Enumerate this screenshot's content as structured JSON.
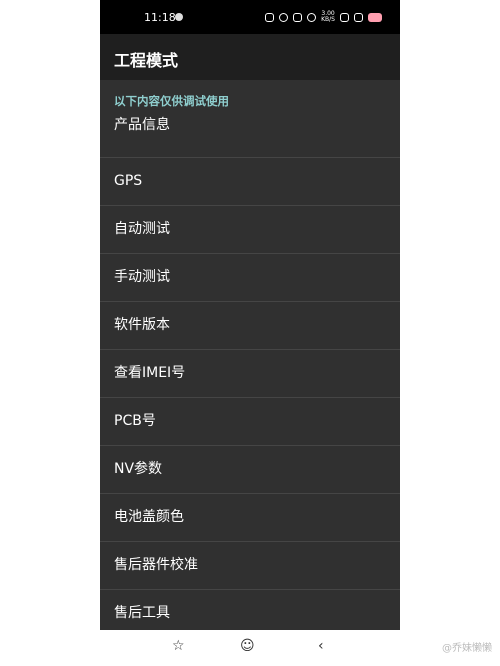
{
  "status_bar": {
    "time": "11:18",
    "net_speed_top": "3.00",
    "net_speed_unit": "KB/S",
    "battery_color": "#ff9fb0"
  },
  "app_bar": {
    "title": "工程模式"
  },
  "list": {
    "section_header": "以下内容仅供调试使用",
    "items": [
      "产品信息",
      "GPS",
      "自动测试",
      "手动测试",
      "软件版本",
      "查看IMEI号",
      "PCB号",
      "NV参数",
      "电池盖颜色",
      "售后器件校准",
      "售后工具"
    ]
  },
  "nav_bar": {
    "home_icon": "star-icon",
    "recents_icon": "face-icon",
    "back_icon": "chevron-left-icon"
  },
  "watermark": "@乔妹懒懒",
  "colors": {
    "background": "#303030",
    "app_bar": "#1f1f1f",
    "section_header": "#8fcfcf",
    "divider": "#454545"
  }
}
